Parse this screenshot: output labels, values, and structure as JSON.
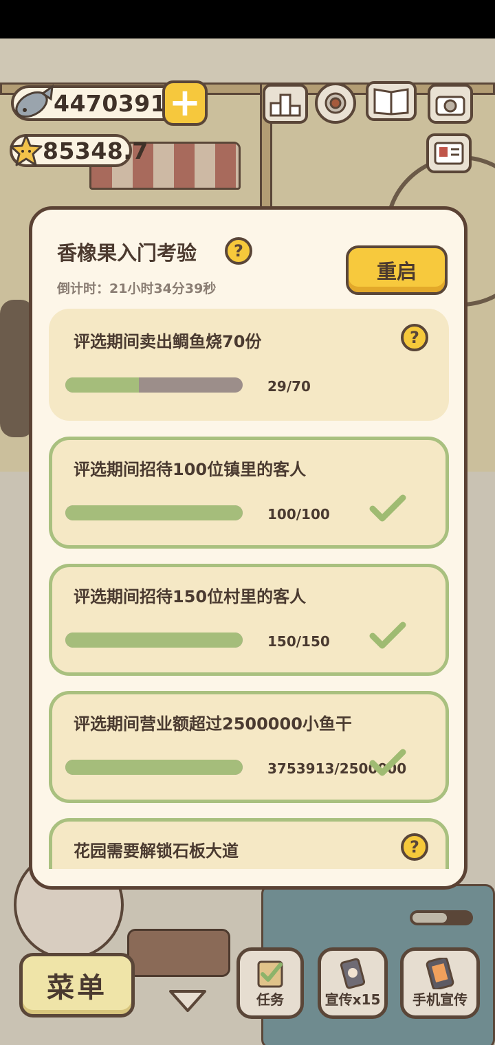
{
  "hud": {
    "fish_coins": "44703917",
    "stars": "85348.7"
  },
  "modal": {
    "title": "香橡果入门考验",
    "countdown": "倒计时：21小时34分39秒",
    "restart_label": "重启",
    "tasks": [
      {
        "text": "评选期间卖出鲷鱼烧70份",
        "progress_text": "29/70",
        "progress_fraction": 0.414,
        "completed": false
      },
      {
        "text": "评选期间招待100位镇里的客人",
        "progress_text": "100/100",
        "progress_fraction": 1.0,
        "completed": true
      },
      {
        "text": "评选期间招待150位村里的客人",
        "progress_text": "150/150",
        "progress_fraction": 1.0,
        "completed": true
      },
      {
        "text": "评选期间营业额超过2500000小鱼干",
        "progress_text": "3753913/2500000",
        "progress_fraction": 1.0,
        "completed": true
      },
      {
        "text": "花园需要解锁石板大道",
        "completed": false
      }
    ]
  },
  "bottom_bar": {
    "menu_label": "菜单",
    "task_label": "任务",
    "promo_label": "宣传x15",
    "phone_promo_label": "手机宣传"
  },
  "colors": {
    "accent_yellow": "#f6c83d",
    "progress_green": "#a5bd7b",
    "outline_brown": "#5a4638",
    "card_bg": "#f5e8c5"
  }
}
